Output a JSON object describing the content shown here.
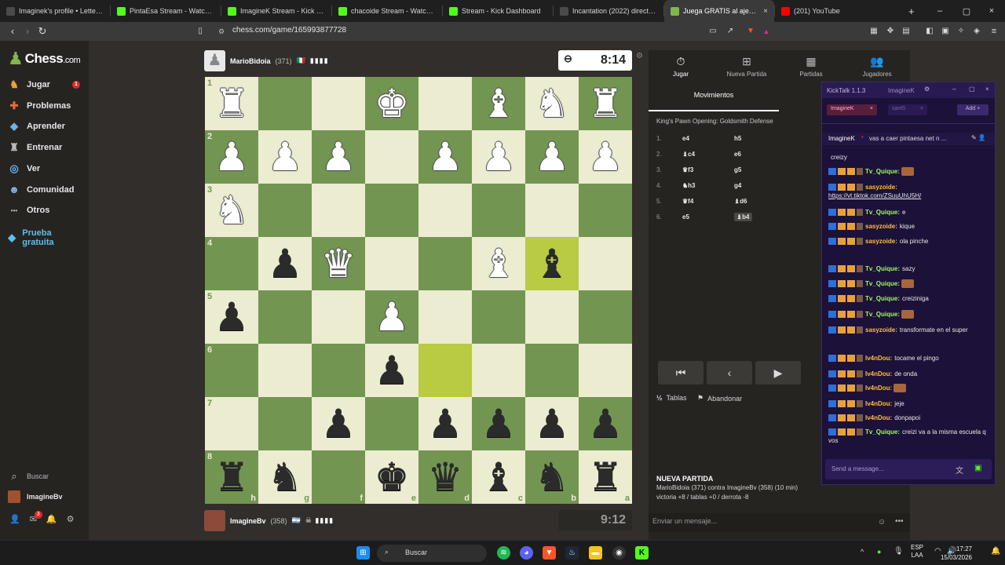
{
  "browser": {
    "tabs": [
      {
        "title": "Imaginek's profile • Letterboxd",
        "icon_color": "#4a4a4a",
        "icon": "letterboxd-icon"
      },
      {
        "title": "PintaEsa Stream - Watch Li",
        "icon_color": "#53fc18",
        "icon": "kick-icon"
      },
      {
        "title": "ImagineK Stream - Kick Da",
        "icon_color": "#53fc18",
        "icon": "kick-icon"
      },
      {
        "title": "chacoide Stream - Watch Live",
        "icon_color": "#53fc18",
        "icon": "kick-icon"
      },
      {
        "title": "Stream - Kick Dashboard",
        "icon_color": "#53fc18",
        "icon": "kick-icon"
      },
      {
        "title": "Incantation (2022) directed by",
        "icon_color": "#4a4a4a",
        "icon": "letterboxd-icon"
      },
      {
        "title": "Juega GRATIS al ajedrez o",
        "icon_color": "#81b64c",
        "icon": "chess-icon",
        "active": true
      },
      {
        "title": "(201) YouTube",
        "icon_color": "#ff0000",
        "icon": "youtube-icon"
      }
    ],
    "url": "chess.com/game/165993877728"
  },
  "sidebar": {
    "logo": "Chess",
    "logo_suffix": ".com",
    "items": [
      {
        "label": "Jugar",
        "icon": "play-icon",
        "badge": "1"
      },
      {
        "label": "Problemas",
        "icon": "puzzle-icon"
      },
      {
        "label": "Aprender",
        "icon": "learn-icon"
      },
      {
        "label": "Entrenar",
        "icon": "train-icon"
      },
      {
        "label": "Ver",
        "icon": "watch-icon"
      },
      {
        "label": "Comunidad",
        "icon": "community-icon"
      },
      {
        "label": "Otros",
        "icon": "more-icon"
      },
      {
        "label": "Prueba gratuita",
        "icon": "diamond-icon"
      }
    ],
    "search": "Buscar",
    "user": "ImagineBv",
    "mail_badge": "3"
  },
  "game": {
    "top_player": {
      "name": "MarioBidoia",
      "rating": "(371)",
      "flag": "🇮🇹",
      "clock": "8:14"
    },
    "bottom_player": {
      "name": "ImagineBv",
      "rating": "(358)",
      "flag": "🇦🇷",
      "clock": "9:12"
    },
    "board": [
      [
        "wR",
        "",
        "",
        "wK",
        "",
        "wB",
        "wN",
        "wR"
      ],
      [
        "wP",
        "wP",
        "wP",
        "",
        "wP",
        "wP",
        "wP",
        "wP"
      ],
      [
        "wN",
        "",
        "",
        "",
        "",
        "",
        "",
        ""
      ],
      [
        "",
        "bP",
        "wQ",
        "",
        "",
        "wB",
        "bB",
        ""
      ],
      [
        "bP",
        "",
        "",
        "wP",
        "",
        "",
        "",
        ""
      ],
      [
        "",
        "",
        "",
        "bP",
        "",
        "",
        "",
        ""
      ],
      [
        "",
        "",
        "bP",
        "",
        "bP",
        "bP",
        "bP",
        "bP"
      ],
      [
        "bR",
        "bN",
        "",
        "bK",
        "bQ",
        "bB",
        "bN",
        "bR"
      ]
    ],
    "ranks": [
      "1",
      "2",
      "3",
      "4",
      "5",
      "6",
      "7",
      "8"
    ],
    "files": [
      "h",
      "g",
      "f",
      "e",
      "d",
      "c",
      "b",
      "a"
    ],
    "highlight": [
      [
        3,
        6
      ],
      [
        5,
        4
      ]
    ]
  },
  "panel": {
    "tabs": [
      {
        "label": "Jugar",
        "icon": "clock-icon",
        "active": true
      },
      {
        "label": "Nueva Partida",
        "icon": "plus-icon"
      },
      {
        "label": "Partidas",
        "icon": "board-icon"
      },
      {
        "label": "Jugadores",
        "icon": "players-icon"
      }
    ],
    "moves_tab": "Movimientos",
    "opening": "King's Pawn Opening: Goldsmith Defense",
    "moves": [
      {
        "n": "1.",
        "w": "e4",
        "b": "h5"
      },
      {
        "n": "2.",
        "w": "♝c4",
        "b": "e6"
      },
      {
        "n": "3.",
        "w": "♛f3",
        "b": "g5"
      },
      {
        "n": "4.",
        "w": "♞h3",
        "b": "g4"
      },
      {
        "n": "5.",
        "w": "♛f4",
        "b": "♝d6"
      },
      {
        "n": "6.",
        "w": "e5",
        "b": "♝b4"
      }
    ],
    "draw": "Tablas",
    "draw_prefix": "½",
    "resign": "Abandonar",
    "newgame": {
      "title": "NUEVA PARTIDA",
      "line1": "MarioBidoia (371) contra ImagineBv (358) (10 min)",
      "line2": "victoria +8 / tablas +0 / derrota -8"
    },
    "chat_placeholder": "Enviar un mensaje..."
  },
  "kicktalk": {
    "title": "KickTalk 1.1.3",
    "user": "ImagineK",
    "chips": [
      "ImagineK",
      "sant5"
    ],
    "add": "Add",
    "pinned": "ImagineK",
    "pinned_text": "vas a caer pintaesa net n ...",
    "messages": [
      {
        "user": "",
        "text": "creizy",
        "color": "#fff"
      },
      {
        "user": "Tv_Quique:",
        "text": "",
        "color": "#a4f26c"
      },
      {
        "user": "sasyzoide:",
        "text": "https://vt.tiktok.com/ZSuuUhU5H/",
        "color": "#ffbe3d"
      },
      {
        "user": "Tv_Quique:",
        "text": "e",
        "color": "#a4f26c"
      },
      {
        "user": "sasyzoide:",
        "text": "kique",
        "color": "#ffbe3d"
      },
      {
        "user": "sasyzoide:",
        "text": "ola pinche",
        "color": "#ffbe3d"
      },
      {
        "user": "Tv_Quique:",
        "text": "sazy",
        "color": "#a4f26c"
      },
      {
        "user": "Tv_Quique:",
        "text": "",
        "color": "#a4f26c"
      },
      {
        "user": "Tv_Quique:",
        "text": "creiziniga",
        "color": "#a4f26c"
      },
      {
        "user": "Tv_Quique:",
        "text": "",
        "color": "#a4f26c"
      },
      {
        "user": "sasyzoide:",
        "text": "transformate en el super",
        "color": "#ffbe3d"
      },
      {
        "user": "Iv4nDou:",
        "text": "tocame el pingo",
        "color": "#ffbe3d"
      },
      {
        "user": "Iv4nDou:",
        "text": "de onda",
        "color": "#ffbe3d"
      },
      {
        "user": "Iv4nDou:",
        "text": "",
        "color": "#ffbe3d"
      },
      {
        "user": "Iv4nDou:",
        "text": "jeje",
        "color": "#ffbe3d"
      },
      {
        "user": "Iv4nDou:",
        "text": "donpapoi",
        "color": "#ffbe3d"
      },
      {
        "user": "Tv_Quique:",
        "text": "creizi va a la misma escuela q vos",
        "color": "#a4f26c"
      }
    ],
    "input_placeholder": "Send a message..."
  },
  "taskbar": {
    "search": "Buscar",
    "lang": "ESP",
    "lang2": "LAA",
    "time": "17:27",
    "date": "15/03/2026"
  }
}
